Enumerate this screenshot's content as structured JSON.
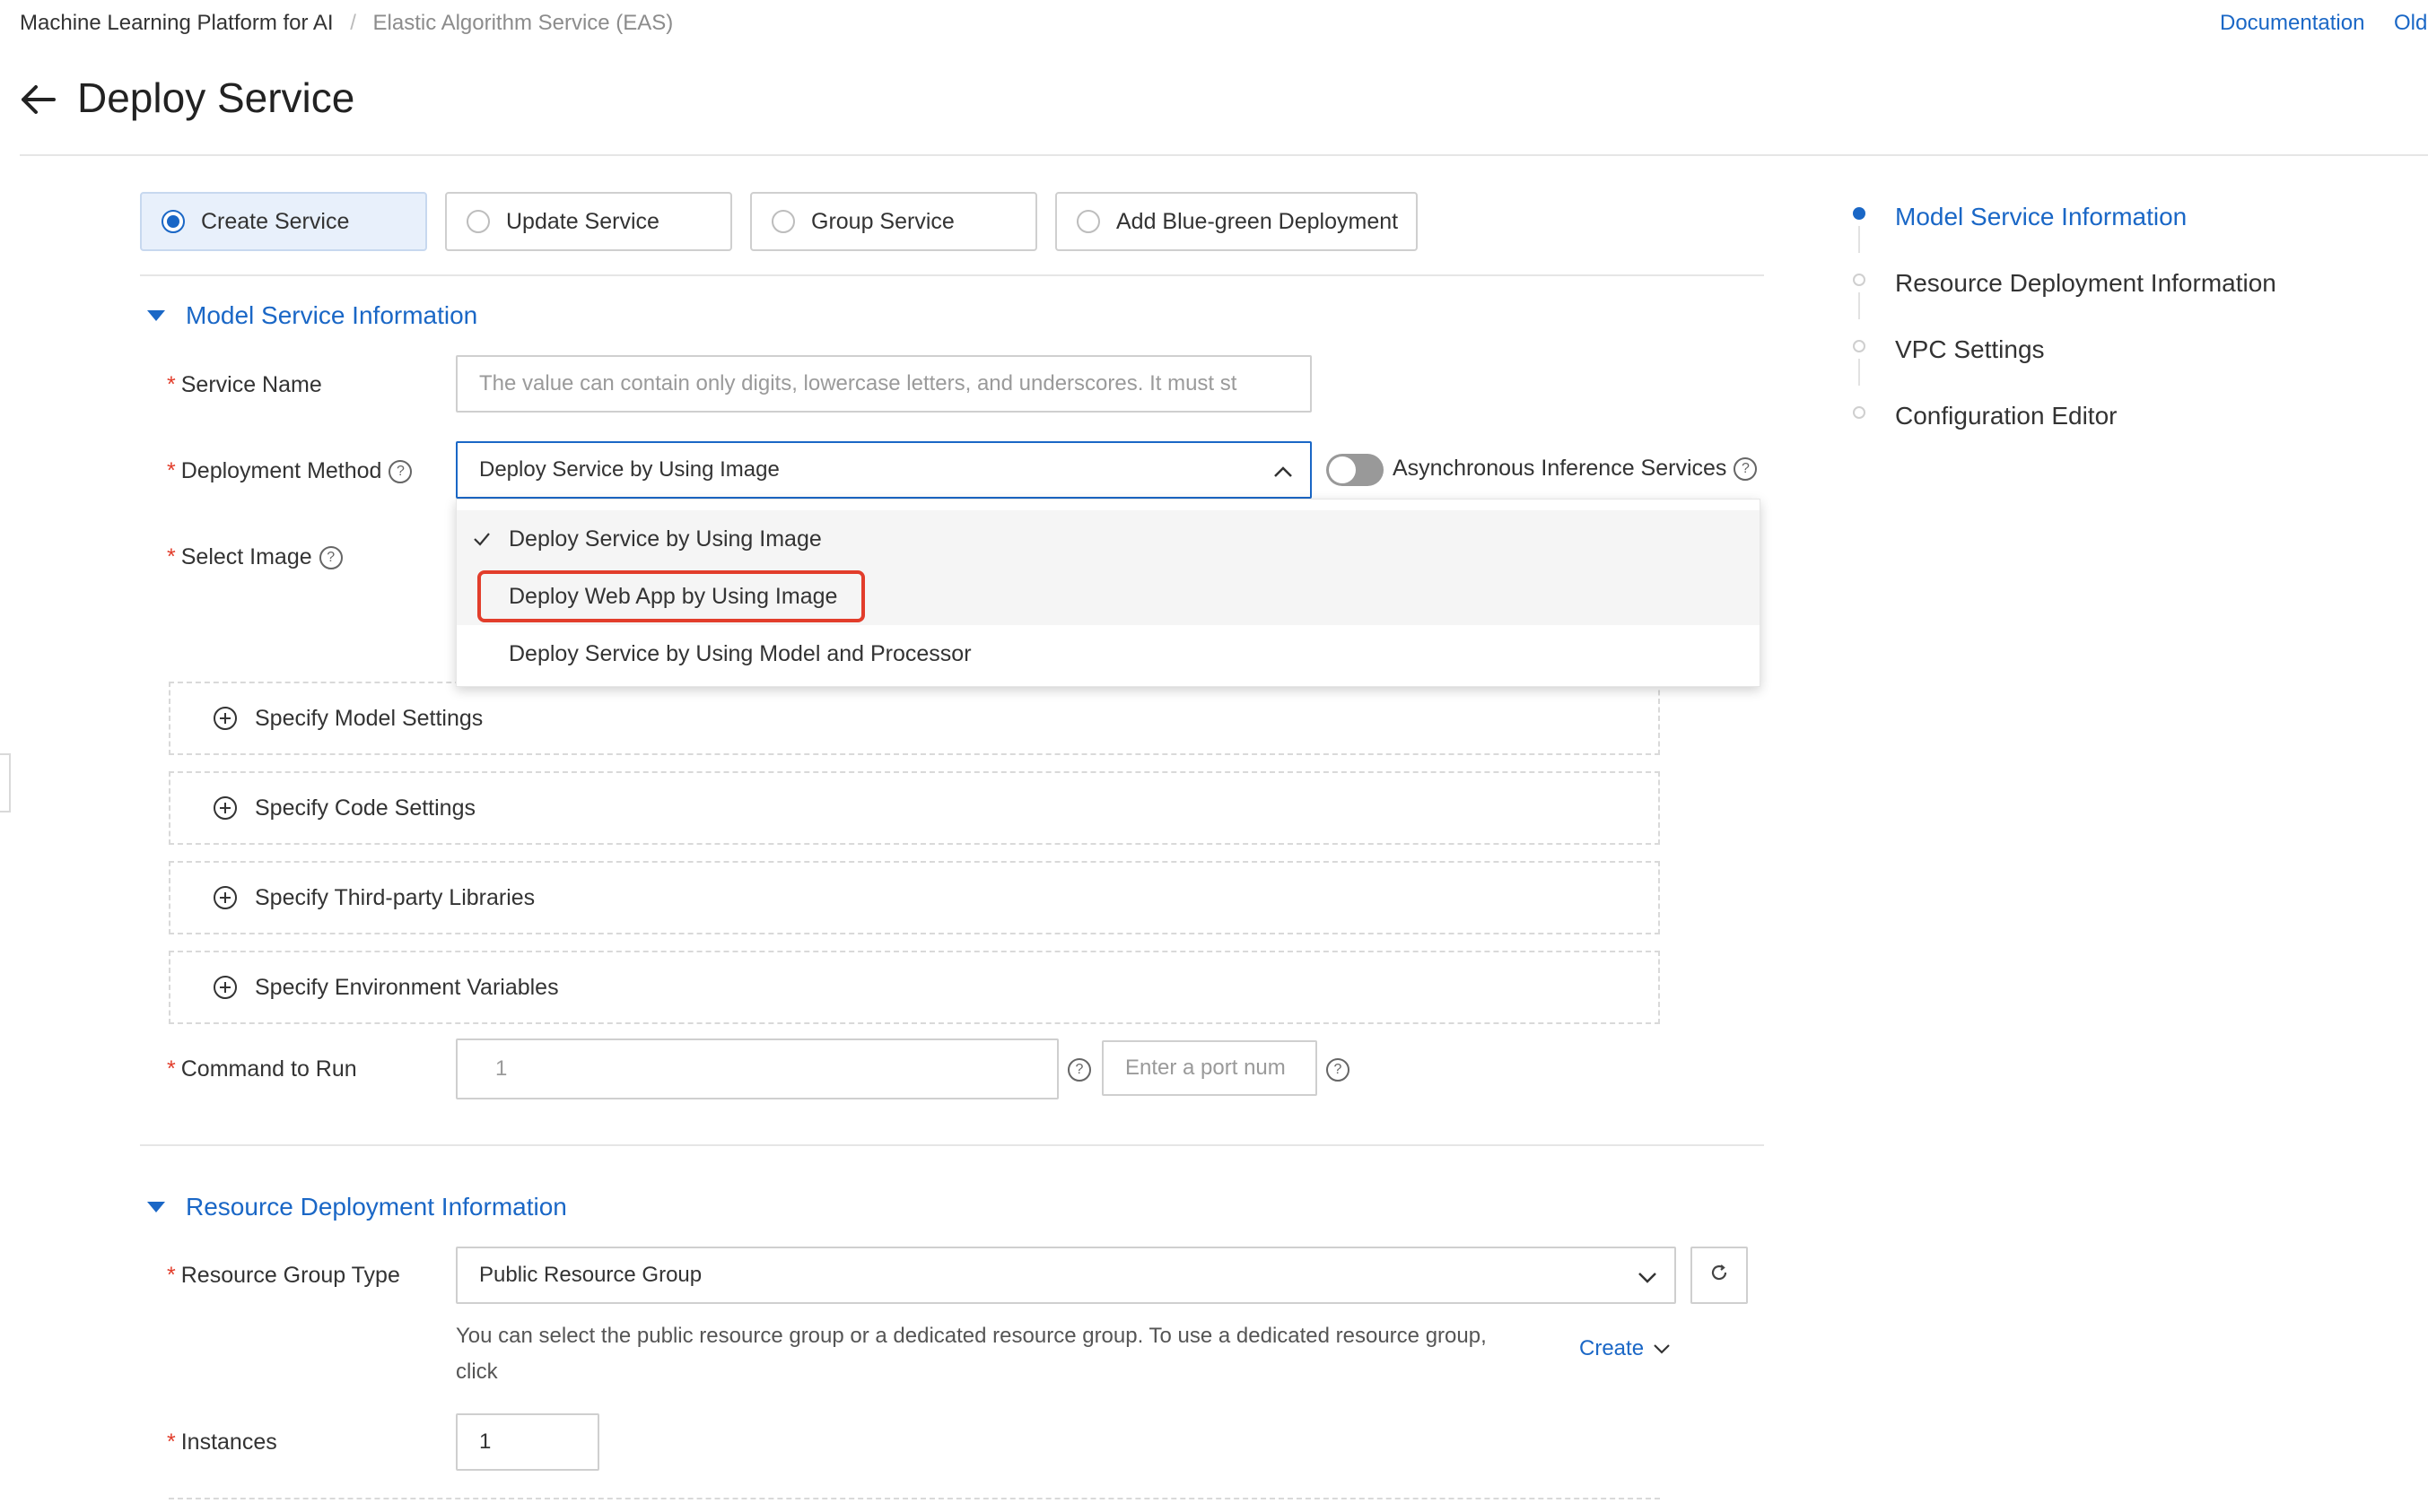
{
  "breadcrumb": {
    "root": "Machine Learning Platform for AI",
    "separator": "/",
    "current": "Elastic Algorithm Service (EAS)"
  },
  "header_links": {
    "documentation": "Documentation",
    "old": "Old"
  },
  "page": {
    "back_icon": "arrow-left-icon",
    "title": "Deploy Service"
  },
  "service_type": {
    "options": [
      "Create Service",
      "Update Service",
      "Group Service",
      "Add Blue-green Deployment"
    ],
    "selected": "Create Service"
  },
  "sections": {
    "model_info": "Model Service Information",
    "resource_info": "Resource Deployment Information"
  },
  "form": {
    "required_mark": "*",
    "service_name_label": "Service Name",
    "service_name_placeholder": "The value can contain only digits, lowercase letters, and underscores. It must st",
    "deployment_method_label": "Deployment Method",
    "deployment_method_value": "Deploy Service by Using Image",
    "async_label": "Asynchronous Inference Services",
    "select_image_label": "Select Image",
    "command_label": "Command to Run",
    "command_line_number": "1",
    "port_placeholder": "Enter a port num",
    "resource_group_label": "Resource Group Type",
    "resource_group_value": "Public Resource Group",
    "resource_group_help": "You can select the public resource group or a dedicated resource group. To use a dedicated resource group,",
    "resource_group_help_2": "click",
    "create_link": "Create",
    "instances_label": "Instances",
    "instances_value": "1"
  },
  "dropdown": {
    "options": [
      "Deploy Service by Using Image",
      "Deploy Web App by Using Image",
      "Deploy Service by Using Model and Processor"
    ],
    "selected": "Deploy Service by Using Image",
    "highlighted": "Deploy Web App by Using Image",
    "highlight_color": "#e23d2b"
  },
  "collapsibles": [
    "Specify Model Settings",
    "Specify Code Settings",
    "Specify Third-party Libraries",
    "Specify Environment Variables"
  ],
  "anchor_nav": {
    "items": [
      "Model Service Information",
      "Resource Deployment Information",
      "VPC Settings",
      "Configuration Editor"
    ],
    "active": "Model Service Information"
  },
  "colors": {
    "accent": "#1a67c6",
    "required": "#e23d2b",
    "selected_bg": "#e8f0fb"
  }
}
